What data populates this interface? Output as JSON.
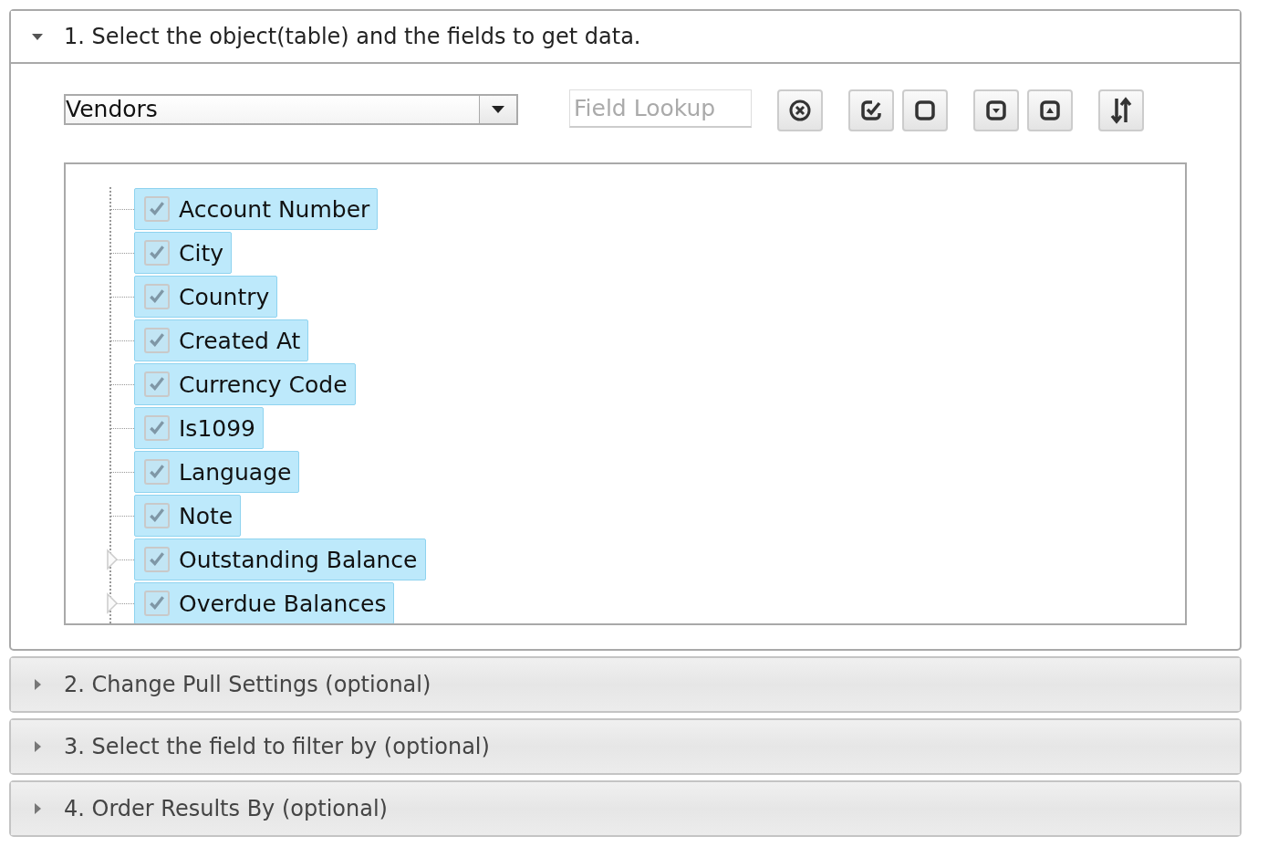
{
  "sections": [
    {
      "title": "1. Select the object(table) and the fields to get data.",
      "expanded": true
    },
    {
      "title": "2. Change Pull Settings (optional)",
      "expanded": false
    },
    {
      "title": "3. Select the field to filter by (optional)",
      "expanded": false
    },
    {
      "title": "4. Order Results By (optional)",
      "expanded": false
    }
  ],
  "object_select": {
    "value": "Vendors"
  },
  "field_lookup": {
    "placeholder": "Field Lookup"
  },
  "toolbar": [
    {
      "kind": "clear"
    },
    {
      "kind": "check-all"
    },
    {
      "kind": "uncheck-all"
    },
    {
      "kind": "expand-all"
    },
    {
      "kind": "collapse-all"
    },
    {
      "kind": "sort"
    }
  ],
  "fields": [
    {
      "label": "Account Number",
      "checked": true,
      "selected": true,
      "expandable": false
    },
    {
      "label": "City",
      "checked": true,
      "selected": true,
      "expandable": false
    },
    {
      "label": "Country",
      "checked": true,
      "selected": true,
      "expandable": false
    },
    {
      "label": "Created At",
      "checked": true,
      "selected": true,
      "expandable": false
    },
    {
      "label": "Currency Code",
      "checked": true,
      "selected": true,
      "expandable": false
    },
    {
      "label": "Is1099",
      "checked": true,
      "selected": true,
      "expandable": false
    },
    {
      "label": "Language",
      "checked": true,
      "selected": true,
      "expandable": false
    },
    {
      "label": "Note",
      "checked": true,
      "selected": true,
      "expandable": false
    },
    {
      "label": "Outstanding Balance",
      "checked": true,
      "selected": true,
      "expandable": true
    },
    {
      "label": "Overdue Balances",
      "checked": true,
      "selected": true,
      "expandable": true
    }
  ]
}
